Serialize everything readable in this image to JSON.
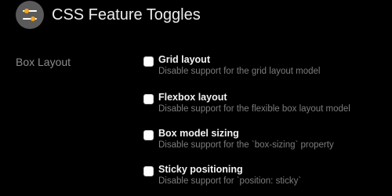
{
  "header": {
    "title": "CSS Feature Toggles",
    "icon": "toggles-icon"
  },
  "section": {
    "label": "Box Layout"
  },
  "options": [
    {
      "title": "Grid layout",
      "description": "Disable support for the grid layout model",
      "checked": false
    },
    {
      "title": "Flexbox layout",
      "description": "Disable support for the flexible box layout model",
      "checked": false
    },
    {
      "title": "Box model sizing",
      "description": "Disable support for the `box-sizing` property",
      "checked": false
    },
    {
      "title": "Sticky positioning",
      "description": "Disable support for `position: sticky`",
      "checked": false
    }
  ],
  "colors": {
    "background": "#000000",
    "icon_bg": "#5a5a5a",
    "toggle_knob": "#f5a623"
  }
}
